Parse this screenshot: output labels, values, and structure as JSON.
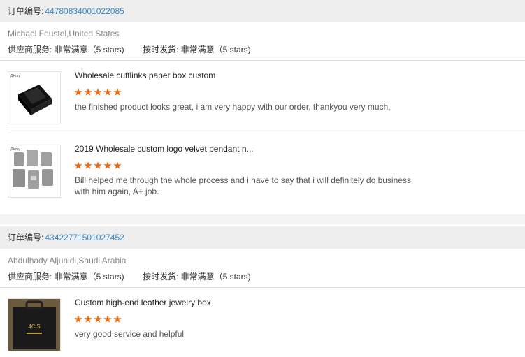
{
  "orders": [
    {
      "label": "订单编号:",
      "number": "44780834001022085",
      "buyer": "Michael Feustel,United States",
      "supplier_service": "供应商服务: 非常满意（5 stars)",
      "on_time_delivery": "按时发货: 非常满意（5 stars)",
      "items": [
        {
          "title": "Wholesale cufflinks paper box custom",
          "stars": 5,
          "review": "the finished product looks great, i am very happy with our order, thankyou very much,",
          "thumb_logo": "Ԫmy"
        },
        {
          "title": "2019 Wholesale custom logo velvet pendant n...",
          "stars": 5,
          "review": "Bill helped me through the whole process and i have to say that i will definitely do business with him again, A+ job.",
          "thumb_logo": "Ԫmy"
        }
      ]
    },
    {
      "label": "订单编号:",
      "number": "43422771501027452",
      "buyer": "Abdulhady Aljunidi,Saudi Arabia",
      "supplier_service": "供应商服务: 非常满意（5 stars)",
      "on_time_delivery": "按时发货: 非常满意（5 stars)",
      "items": [
        {
          "title": "Custom high-end leather jewelry box",
          "stars": 5,
          "review": "very good service and helpful",
          "thumb_logo": "4C'S"
        }
      ]
    }
  ],
  "colors": {
    "order_number": "#3a87c8",
    "star": "#f06a10",
    "header_bg": "#eeeeee"
  }
}
